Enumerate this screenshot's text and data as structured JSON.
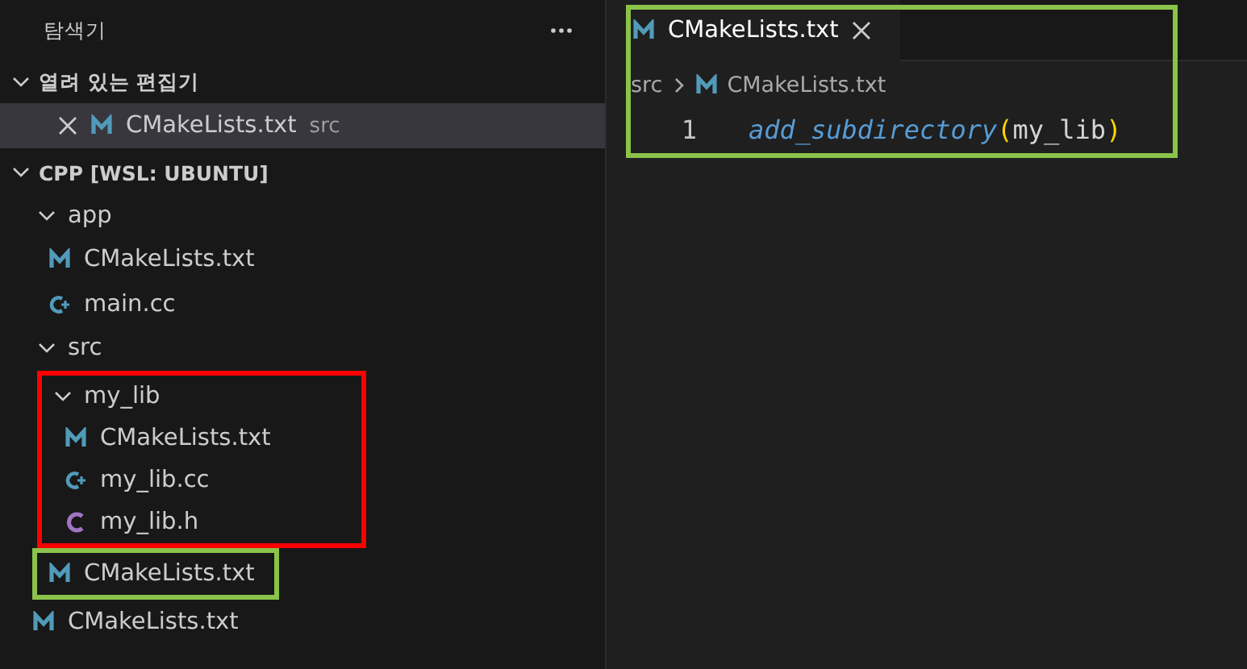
{
  "sidebar": {
    "title": "탐색기",
    "open_editors": {
      "title": "열려 있는 편집기",
      "expanded": true,
      "items": [
        {
          "name": "CMakeLists.txt",
          "folder": "src",
          "kind": "cmake",
          "selected": true
        }
      ]
    },
    "workspace": {
      "title": "CPP [WSL: UBUNTU]",
      "expanded": true,
      "tree": [
        {
          "name": "app",
          "kind": "folder",
          "expanded": true,
          "children": [
            {
              "name": "CMakeLists.txt",
              "kind": "cmake"
            },
            {
              "name": "main.cc",
              "kind": "cpp"
            }
          ]
        },
        {
          "name": "src",
          "kind": "folder",
          "expanded": true,
          "children": [
            {
              "name": "my_lib",
              "kind": "folder",
              "expanded": true,
              "color": "#ff0000",
              "children": [
                {
                  "name": "CMakeLists.txt",
                  "kind": "cmake"
                },
                {
                  "name": "my_lib.cc",
                  "kind": "cpp"
                },
                {
                  "name": "my_lib.h",
                  "kind": "c"
                }
              ]
            },
            {
              "name": "CMakeLists.txt",
              "kind": "cmake",
              "color": "#8bc34a"
            }
          ]
        },
        {
          "name": "CMakeLists.txt",
          "kind": "cmake"
        }
      ]
    }
  },
  "editor": {
    "color": "#8bc34a",
    "tabs": [
      {
        "label": "CMakeLists.txt",
        "kind": "cmake",
        "selected": true
      }
    ],
    "breadcrumb": [
      {
        "label": "src",
        "kind": "folder"
      },
      {
        "label": "CMakeLists.txt",
        "kind": "cmake"
      }
    ],
    "lines": [
      {
        "number": "1",
        "tokens": [
          {
            "text": "add_subdirectory",
            "kind": "function"
          },
          {
            "text": "(",
            "kind": "bracket"
          },
          {
            "text": "my_lib",
            "kind": "plain"
          },
          {
            "text": ")",
            "kind": "bracket"
          }
        ]
      }
    ]
  }
}
